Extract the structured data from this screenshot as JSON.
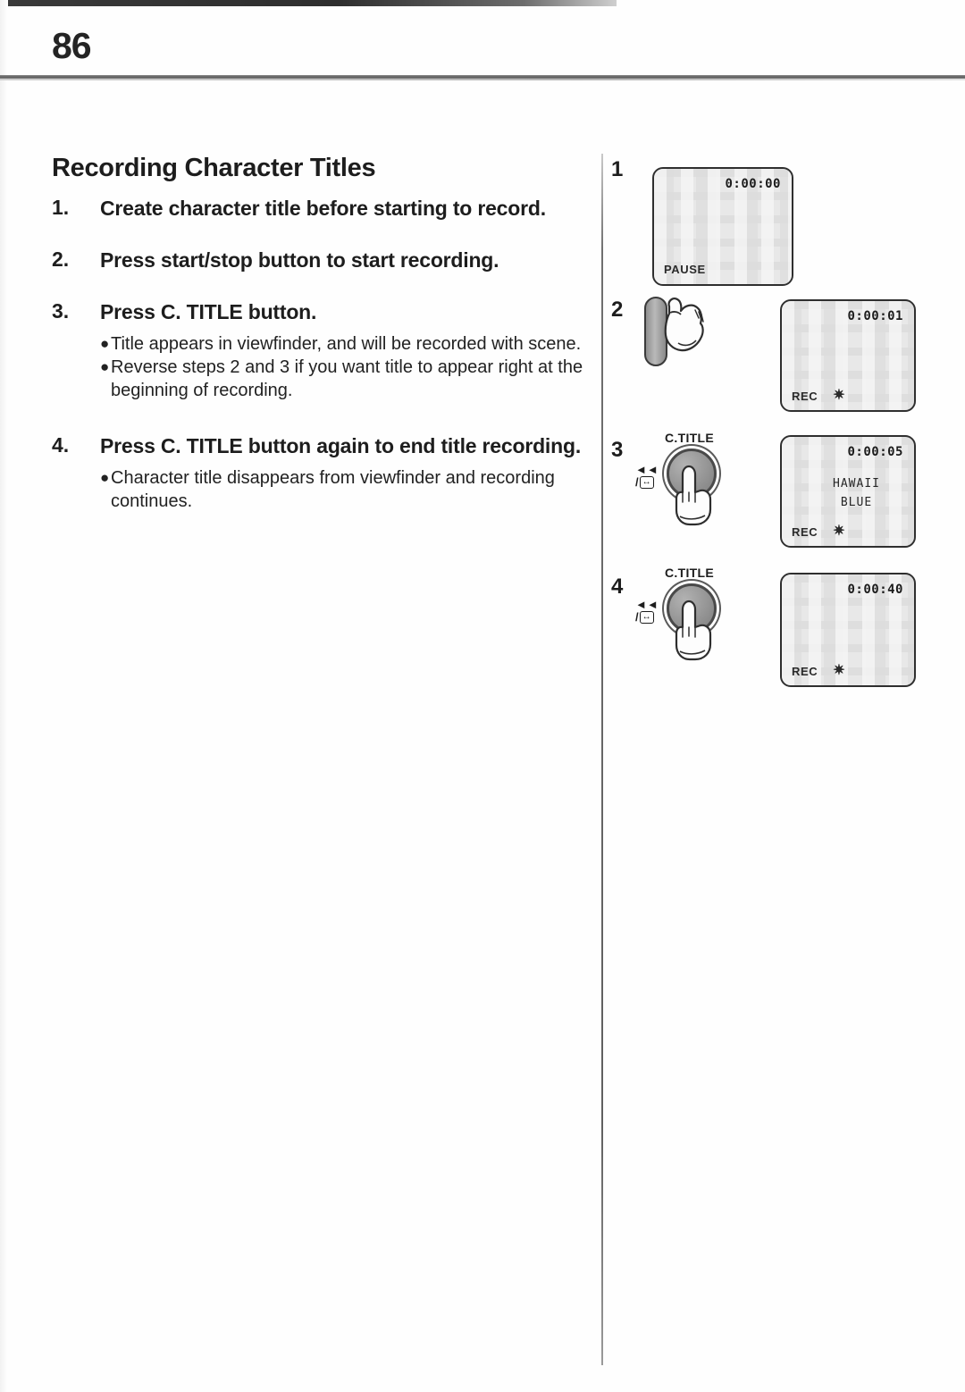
{
  "page": {
    "number": "86"
  },
  "content": {
    "heading": "Recording Character Titles",
    "steps": [
      {
        "num": "1.",
        "text": "Create character title before starting to record.",
        "bullets": []
      },
      {
        "num": "2.",
        "text": "Press start/stop button to start recording.",
        "bullets": []
      },
      {
        "num": "3.",
        "text": "Press C. TITLE button.",
        "bullets": [
          "Title appears in viewfinder, and will be recorded with scene.",
          "Reverse steps 2 and 3 if you want title to appear right at the beginning of recording."
        ]
      },
      {
        "num": "4.",
        "text": "Press C. TITLE button again to end title recording.",
        "bullets": [
          "Character title disappears from viewfinder and recording continues."
        ]
      }
    ]
  },
  "figures": [
    {
      "num": "1",
      "screen": {
        "timecode": "0:00:00",
        "status": "PAUSE",
        "rec_label": "",
        "rec_star": "",
        "title_line1": "",
        "title_line2": ""
      }
    },
    {
      "num": "2",
      "control": {
        "type": "start-stop-bar",
        "label": ""
      },
      "screen": {
        "timecode": "0:00:01",
        "status": "",
        "rec_label": "REC",
        "rec_star": "✷",
        "title_line1": "",
        "title_line2": ""
      }
    },
    {
      "num": "3",
      "control": {
        "type": "round-button",
        "label": "C.TITLE",
        "rewind_icon": "◄◄",
        "slash": "/",
        "box_icon": "↔"
      },
      "screen": {
        "timecode": "0:00:05",
        "status": "",
        "rec_label": "REC",
        "rec_star": "✷",
        "title_line1": "HAWAII",
        "title_line2": "BLUE"
      }
    },
    {
      "num": "4",
      "control": {
        "type": "round-button",
        "label": "C.TITLE",
        "rewind_icon": "◄◄",
        "slash": "/",
        "box_icon": "↔"
      },
      "screen": {
        "timecode": "0:00:40",
        "status": "",
        "rec_label": "REC",
        "rec_star": "✷",
        "title_line1": "",
        "title_line2": ""
      }
    }
  ]
}
